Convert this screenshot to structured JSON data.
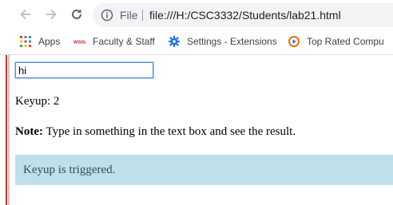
{
  "browser": {
    "scheme_label": "File",
    "url": "file:///H:/CSC3332/Students/lab21.html"
  },
  "bookmarks": [
    {
      "label": "Apps",
      "icon": "apps-grid-icon"
    },
    {
      "label": "Faculty & Staff",
      "icon": "wssu-logo-icon",
      "logo_text": "WSSU"
    },
    {
      "label": "Settings - Extensions",
      "icon": "gear-icon"
    },
    {
      "label": "Top Rated Compu",
      "icon": "play-circle-icon"
    }
  ],
  "page": {
    "input_value": "hi",
    "keyup_text": "Keyup: 2",
    "note_label": "Note:",
    "note_text": " Type in something in the text box and see the result.",
    "alert_text": "Keyup is triggered."
  },
  "colors": {
    "alert_bg": "#bde0ea",
    "left_border": "#d93025",
    "input_focus": "#5b8fd9"
  }
}
